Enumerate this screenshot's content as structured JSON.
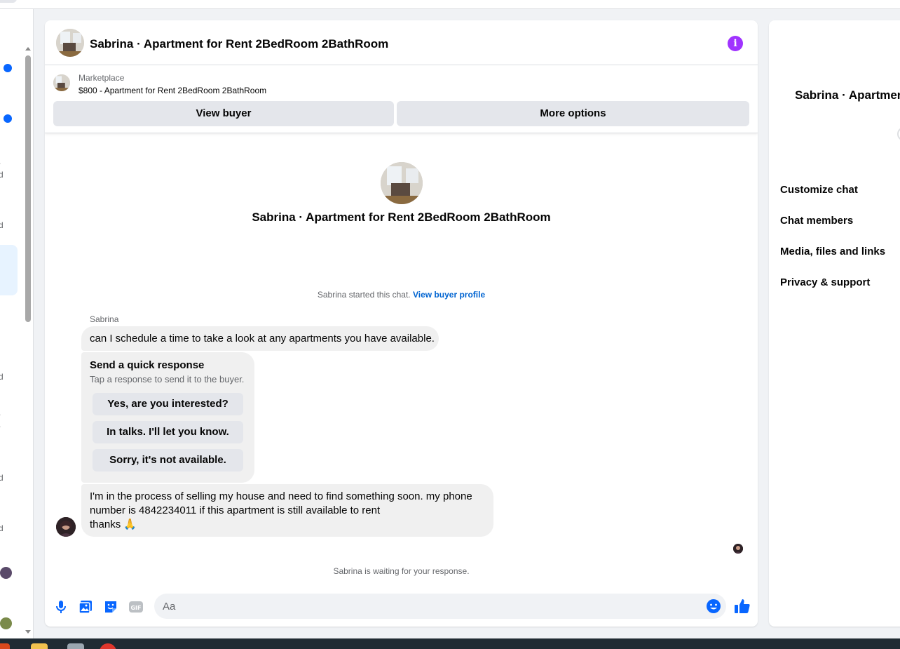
{
  "header": {
    "title": "Sabrina · Apartment for Rent 2BedRoom 2BathRoom",
    "info_icon": "info-icon"
  },
  "listing": {
    "source": "Marketplace",
    "title": "$800 - Apartment for Rent 2BedRoom 2BathRoom",
    "view_buyer_label": "View buyer",
    "more_options_label": "More options"
  },
  "profile": {
    "name": "Sabrina · Apartment for Rent 2BedRoom 2BathRoom"
  },
  "conversation": {
    "started_text": "Sabrina started this chat.",
    "view_profile_link": "View buyer profile",
    "sender_name": "Sabrina",
    "message_1": "can I schedule a time to take a look at any apartments you have available.",
    "quick_response": {
      "title": "Send a quick response",
      "subtitle": "Tap a response to send it to the buyer.",
      "options": [
        "Yes, are you interested?",
        "In talks. I'll let you know.",
        "Sorry, it's not available."
      ]
    },
    "message_2_lines": [
      "I'm in the process of selling my house and need to find something soon. my phone",
      "number is 4842234011 if this apartment is still available to rent",
      "thanks 🙏"
    ],
    "waiting_text": "Sabrina is waiting for your response."
  },
  "composer": {
    "placeholder": "Aa",
    "icons": [
      "microphone-icon",
      "photo-icon",
      "sticker-icon",
      "gif-icon",
      "emoji-icon",
      "thumbs-up-icon"
    ]
  },
  "right_panel": {
    "title": "Sabrina · Apartment",
    "menu": [
      "Customize chat",
      "Chat members",
      "Media, files and links",
      "Privacy & support"
    ]
  },
  "left_rail": {
    "fragments": [
      ".",
      "d",
      "d",
      ".",
      "d",
      ".",
      "d",
      "d",
      "d"
    ]
  },
  "colors": {
    "accent": "#0866ff",
    "info": "#a033ff",
    "link": "#0064d1",
    "bubble": "#f0f0f0",
    "button": "#e4e6eb"
  }
}
